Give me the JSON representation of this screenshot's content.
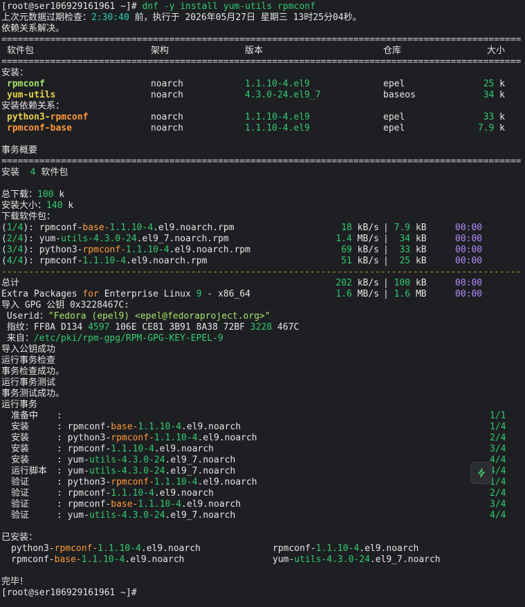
{
  "prompt": "[root@ser106929161961 ~]#",
  "command": " dnf -y install yum-utils rpmconf",
  "metadata_line_prefix": "上次元数据过期检查：",
  "metadata_time": "2:30:40",
  "metadata_mid": " 前，执行于 ",
  "metadata_date": "2026年05月27日 星期三 13时25分04秒。",
  "deps_resolved": "依赖关系解决。",
  "separator": "================================================================================================",
  "dashes": "------------------------------------------------------------------------------------------------",
  "headers": {
    "package": "软件包",
    "arch": "架构",
    "version": "版本",
    "repo": "仓库",
    "size": "大小"
  },
  "installing_label": "安装：",
  "installing_deps_label": "安装依赖关系：",
  "packages": [
    {
      "name": "rpmconf",
      "arch": "noarch",
      "version": "1.1.10-4.el9",
      "repo": "epel",
      "size": "25 k"
    },
    {
      "name": "yum-utils",
      "arch": "noarch",
      "version": "4.3.0-24.el9_7",
      "repo": "baseos",
      "size": "34 k"
    }
  ],
  "deps": [
    {
      "name_a": "python3-",
      "name_b": "rpmconf",
      "arch": "noarch",
      "version": "1.1.10-4.el9",
      "repo": "epel",
      "size": "33 k"
    },
    {
      "name": "rpmconf-base",
      "arch": "noarch",
      "version": "1.1.10-4.el9",
      "repo": "epel",
      "size": "7.9 k"
    }
  ],
  "summary_label": "事务概要",
  "install_count_label": "安装",
  "install_count": "4",
  "install_count_unit": "软件包",
  "total_download_label": "总下载：",
  "total_download": "100 k",
  "install_size_label": "安装大小：",
  "install_size": "140 k",
  "downloading_label": "下载软件包：",
  "downloads": [
    {
      "idx": "(1/4)",
      "a": "rpmconf-",
      "b": "base-",
      "c": "1.1.10-4.el9.noarch.rpm",
      "rate": "18 kB/s",
      "size": "7.9 kB",
      "time": "00:00"
    },
    {
      "idx": "(2/4)",
      "a": "yum-",
      "b": "utils-4.3.0-24.el9_7",
      "c": ".noarch.rpm",
      "rate": "1.4 MB/s",
      "size": "34 kB",
      "time": "00:00"
    },
    {
      "idx": "(3/4)",
      "a": "python3-",
      "b": "rpmconf-1.1.10-4.el9",
      "c": ".noarch.rpm",
      "rate": "69 kB/s",
      "size": "33 kB",
      "time": "00:00"
    },
    {
      "idx": "(4/4)",
      "a": "rpmconf-",
      "b": "1.1.10-4.el9",
      "c": ".noarch.rpm",
      "rate": "51 kB/s",
      "size": "25 kB",
      "time": "00:00"
    }
  ],
  "total_label": "总计",
  "total_rate": "202 kB/s",
  "total_size": "100 kB",
  "total_time": "00:00",
  "epel_line": {
    "a": "Extra Packages ",
    "b": "for",
    "c": " Enterprise Linux ",
    "d": "9",
    "e": " - x86_64",
    "rate": "1.6 MB/s",
    "size": "1.6 MB",
    "time": "00:00"
  },
  "gpg_import": "导入 GPG 公钥 0x3228467C:",
  "userid_label": " Userid：",
  "userid": "\"Fedora (epel9) <epel@fedoraproject.org>\"",
  "fingerprint_label": " 指纹：",
  "fingerprint": {
    "a": "FF8A D134 ",
    "b": "4597",
    "c": " 106E CE81 3B91 8A38 72BF ",
    "d": "3228",
    "e": " 467C"
  },
  "from_label": " 来自：",
  "from_path": "/etc/pki/rpm-gpg/RPM-GPG-KEY-EPEL-9",
  "post_lines": [
    "导入公钥成功",
    "运行事务检查",
    "事务检查成功。",
    "运行事务测试",
    "事务测试成功。",
    "运行事务"
  ],
  "transaction": [
    {
      "action": "  准备中  ",
      "pkg": "",
      "count": "1/1"
    },
    {
      "action": "  安装    ",
      "pkg": "rpmconf-base-1.1.10-4.el9.noarch",
      "count": "1/4"
    },
    {
      "action": "  安装    ",
      "pkg": "python3-rpmconf-1.1.10-4.el9.noarch",
      "count": "2/4"
    },
    {
      "action": "  安装    ",
      "pkg": "rpmconf-1.1.10-4.el9.noarch",
      "count": "3/4"
    },
    {
      "action": "  安装    ",
      "pkg": "yum-utils-4.3.0-24.el9_7.noarch",
      "count": "4/4"
    },
    {
      "action": "  运行脚本",
      "pkg": "yum-utils-4.3.0-24.el9_7.noarch",
      "count": "4/4"
    },
    {
      "action": "  验证    ",
      "pkg": "python3-rpmconf-1.1.10-4.el9.noarch",
      "count": "1/4"
    },
    {
      "action": "  验证    ",
      "pkg": "rpmconf-1.1.10-4.el9.noarch",
      "count": "2/4"
    },
    {
      "action": "  验证    ",
      "pkg": "rpmconf-base-1.1.10-4.el9.noarch",
      "count": "3/4"
    },
    {
      "action": "  验证    ",
      "pkg": "yum-utils-4.3.0-24.el9_7.noarch",
      "count": "4/4"
    }
  ],
  "installed_label": "已安装：",
  "installed": [
    "python3-rpmconf-1.1.10-4.el9.noarch",
    "rpmconf-1.1.10-4.el9.noarch",
    "rpmconf-base-1.1.10-4.el9.noarch",
    "yum-utils-4.3.0-24.el9_7.noarch"
  ],
  "complete": "完毕！",
  "final_prompt": "[root@ser106929161961 ~]#",
  "colors": {
    "green": "#2ecc71",
    "cyan": "#29d3c0",
    "yellow": "#e6d34a",
    "orange": "#ff9a3a",
    "purple": "#b28cff",
    "background": "#1e1f22"
  },
  "floating_button_icon": "lightning-icon"
}
